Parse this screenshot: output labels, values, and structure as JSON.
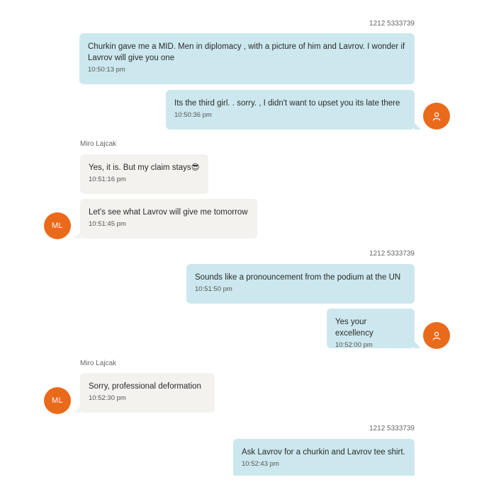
{
  "conversation": {
    "messages": [
      {
        "sender": "1212 5333739",
        "text": "Churkin  gave me a MID.  Men in diplomacy , with a picture of him and Lavrov.  I wonder if Lavrov will give you one",
        "time": "10:50:13 pm"
      },
      {
        "text": "Its the third girl. . sorry. , I didn't want to upset you its late there",
        "time": "10:50:36 pm",
        "avatar_icon": "user-icon"
      },
      {
        "sender": "Miro Lajcak",
        "text": "Yes, it is. But my claim stays😎",
        "time": "10:51:16 pm"
      },
      {
        "text": "Let's see what Lavrov will give me tomorrow",
        "time": "10:51:45 pm",
        "avatar_initials": "ML"
      },
      {
        "sender": "1212 5333739",
        "text": "Sounds like a pronouncement from the podium at the UN",
        "time": "10:51:50 pm"
      },
      {
        "text": "Yes your excellency",
        "time": "10:52:00 pm",
        "avatar_icon": "user-icon"
      },
      {
        "sender": "Miro Lajcak",
        "text": "Sorry, professional deformation",
        "time": "10:52:30 pm",
        "avatar_initials": "ML"
      },
      {
        "sender": "1212 5333739",
        "text": "Ask Lavrov for a churkin and Lavrov tee shirt.",
        "time": "10:52:43 pm"
      }
    ]
  },
  "colors": {
    "outgoing_bubble": "#cce8ee",
    "incoming_bubble": "#f3f2ef",
    "avatar": "#ea6a1c"
  }
}
